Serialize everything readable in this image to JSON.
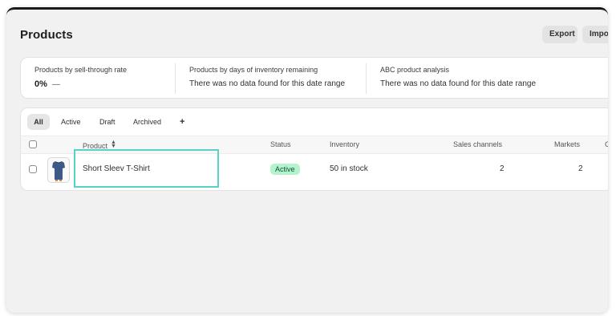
{
  "header": {
    "title": "Products",
    "export_label": "Export",
    "import_label": "Import"
  },
  "analytics": {
    "sell_through": {
      "label": "Products by sell-through rate",
      "value": "0%",
      "trend": "—"
    },
    "days_inventory": {
      "label": "Products by days of inventory remaining",
      "message": "There was no data found for this date range"
    },
    "abc": {
      "label": "ABC product analysis",
      "message": "There was no data found for this date range"
    }
  },
  "tabs": [
    "All",
    "Active",
    "Draft",
    "Archived",
    "+"
  ],
  "columns": {
    "product": "Product",
    "status": "Status",
    "inventory": "Inventory",
    "sales_channels": "Sales channels",
    "markets": "Markets",
    "category": "C"
  },
  "rows": [
    {
      "name": "Short Sleev T-Shirt",
      "status": "Active",
      "inventory": "50 in stock",
      "sales_channels": "2",
      "markets": "2"
    }
  ],
  "colors": {
    "active_badge_bg": "#b5f3cf",
    "active_badge_text": "#0c5132",
    "highlight": "#58d2c8"
  }
}
